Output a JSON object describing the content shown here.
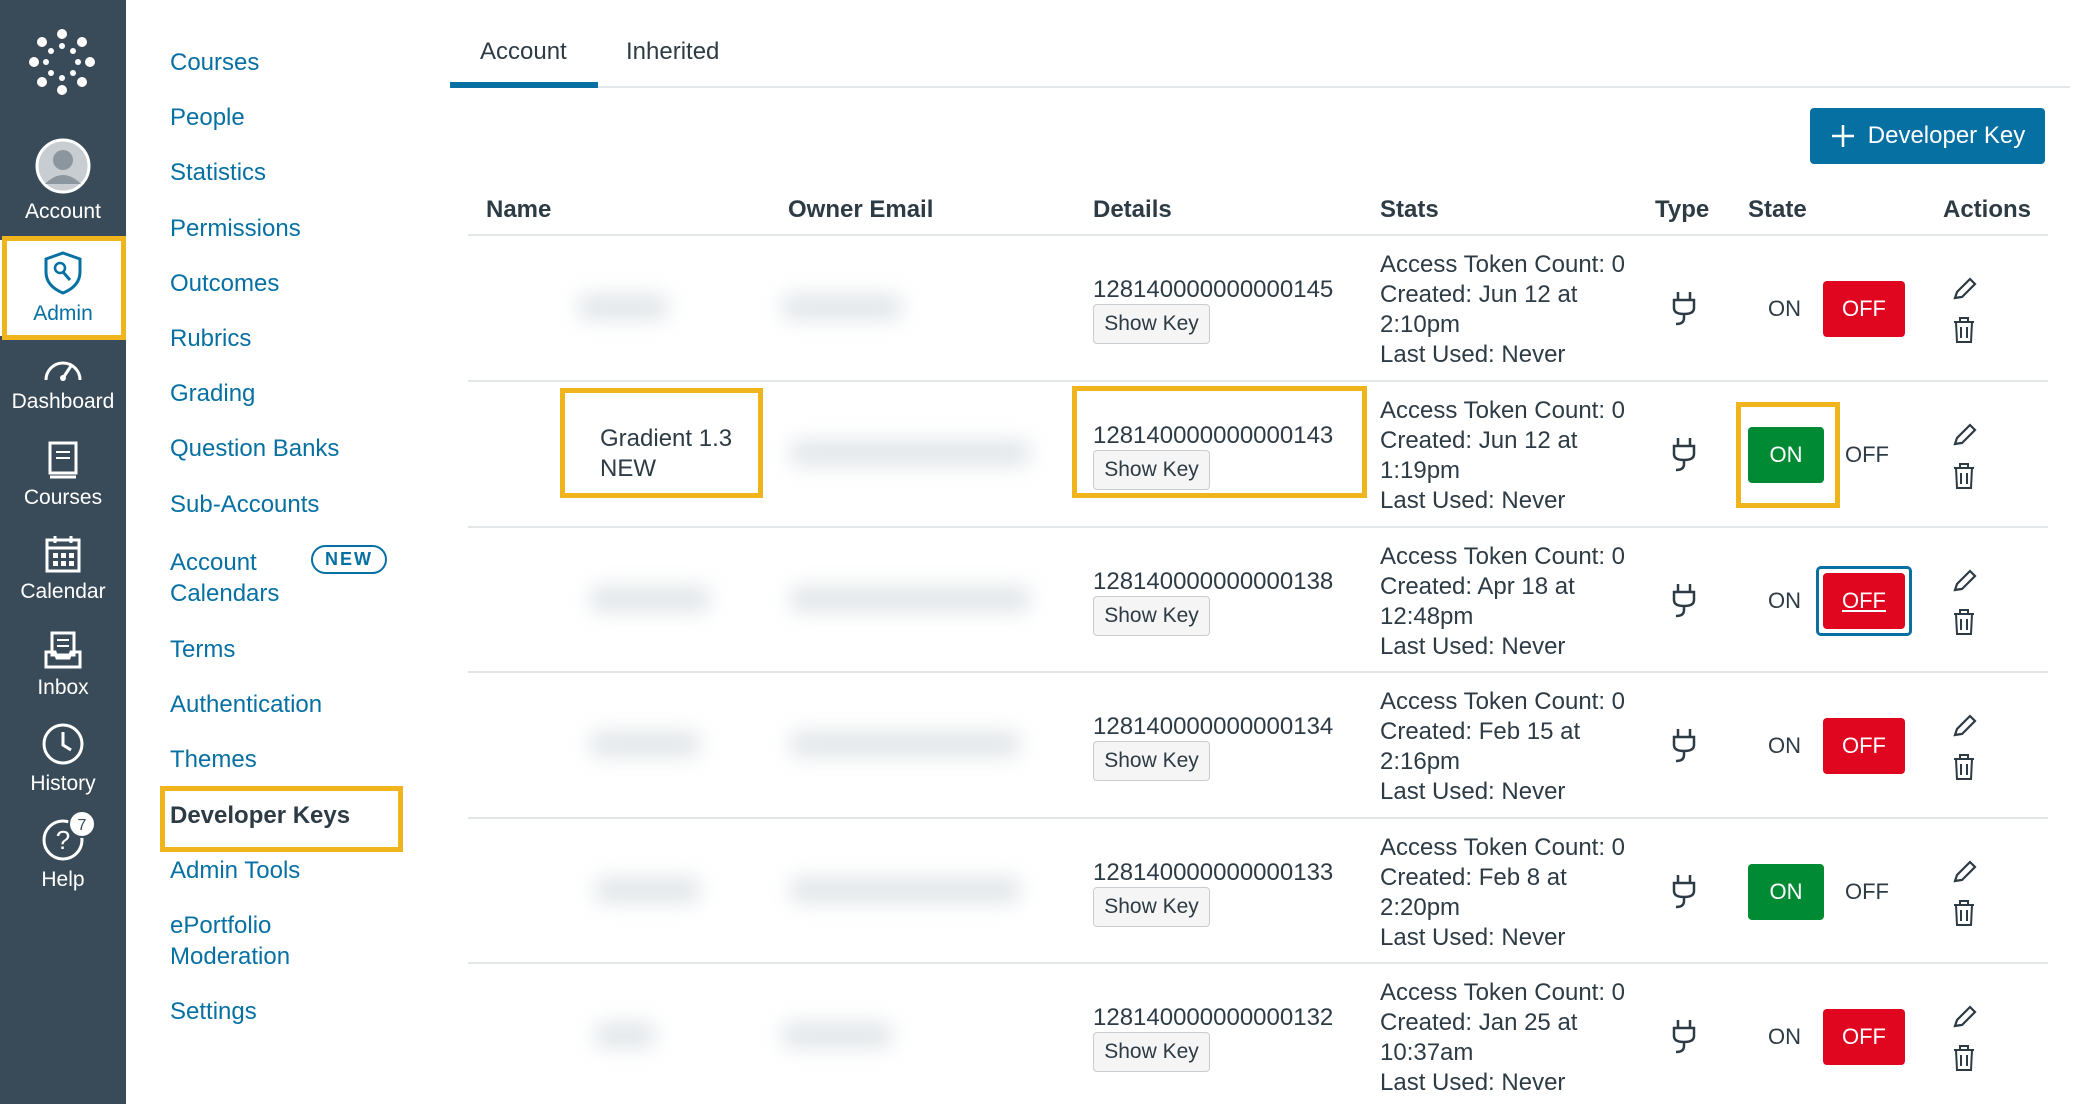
{
  "global_nav": {
    "account": "Account",
    "admin": "Admin",
    "dashboard": "Dashboard",
    "courses": "Courses",
    "calendar": "Calendar",
    "inbox": "Inbox",
    "history": "History",
    "help": "Help",
    "help_badge": "7"
  },
  "sub_nav": {
    "items": [
      "Courses",
      "People",
      "Statistics",
      "Permissions",
      "Outcomes",
      "Rubrics",
      "Grading",
      "Question Banks",
      "Sub-Accounts",
      "Account",
      "Calendars",
      "Terms",
      "Authentication",
      "Themes",
      "Developer Keys",
      "Admin Tools",
      "ePortfolio",
      "Moderation",
      "Settings"
    ],
    "new_badge": "NEW"
  },
  "tabs": [
    "Account",
    "Inherited"
  ],
  "add_button": "Developer Key",
  "table": {
    "headers": [
      "Name",
      "Owner Email",
      "Details",
      "Stats",
      "Type",
      "State",
      "Actions"
    ],
    "show_key_label": "Show Key",
    "on_label": "ON",
    "off_label": "OFF",
    "rows": [
      {
        "name": "",
        "key_id": "128140000000000145",
        "stats": [
          "Access Token Count: 0",
          "Created: Jun 12 at",
          "2:10pm",
          "Last Used: Never"
        ],
        "state": "off"
      },
      {
        "name": "Gradient 1.3 NEW",
        "name_lines": [
          "Gradient 1.3",
          "NEW"
        ],
        "key_id": "128140000000000143",
        "stats": [
          "Access Token Count: 0",
          "Created: Jun 12 at",
          "1:19pm",
          "Last Used: Never"
        ],
        "state": "on"
      },
      {
        "name": "",
        "key_id": "128140000000000138",
        "stats": [
          "Access Token Count: 0",
          "Created: Apr 18 at",
          "12:48pm",
          "Last Used: Never"
        ],
        "state": "off"
      },
      {
        "name": "",
        "key_id": "128140000000000134",
        "stats": [
          "Access Token Count: 0",
          "Created: Feb 15 at",
          "2:16pm",
          "Last Used: Never"
        ],
        "state": "off"
      },
      {
        "name": "",
        "key_id": "128140000000000133",
        "stats": [
          "Access Token Count: 0",
          "Created: Feb 8 at",
          "2:20pm",
          "Last Used: Never"
        ],
        "state": "on"
      },
      {
        "name": "",
        "key_id": "128140000000000132",
        "stats": [
          "Access Token Count: 0",
          "Created: Jan 25 at",
          "10:37am",
          "Last Used: Never"
        ],
        "state": "off"
      }
    ]
  },
  "colors": {
    "nav_bg": "#394b58",
    "link": "#0770a3",
    "off_red": "#e0061f",
    "on_green": "#008a33",
    "highlight": "#f0b41c"
  }
}
